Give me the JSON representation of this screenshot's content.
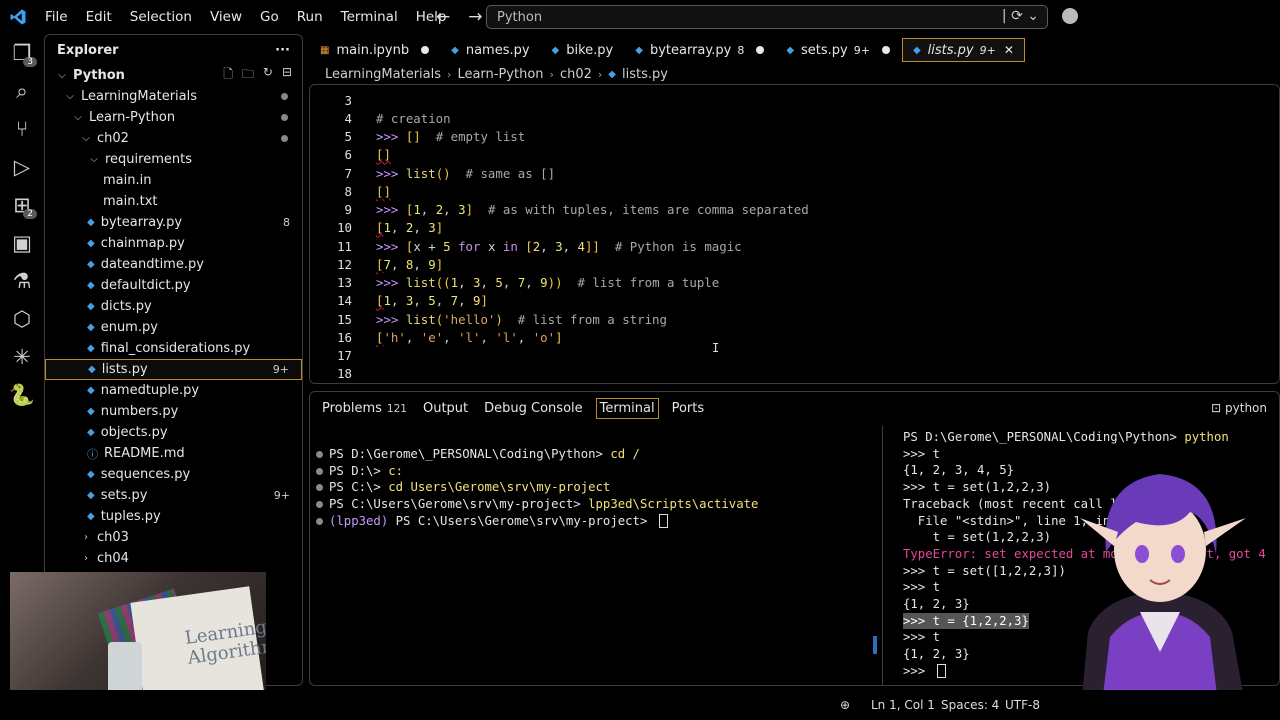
{
  "menu": [
    "File",
    "Edit",
    "Selection",
    "View",
    "Go",
    "Run",
    "Terminal",
    "Help"
  ],
  "command_center": {
    "text": "Python"
  },
  "activity": {
    "explorer_badge": "3",
    "extensions_badge": "2"
  },
  "explorer": {
    "title": "Explorer",
    "root": "Python",
    "tree": [
      {
        "label": "LearningMaterials",
        "indent": 1,
        "type": "folder-open",
        "dot": true
      },
      {
        "label": "Learn-Python",
        "indent": 2,
        "type": "folder-open",
        "dot": true
      },
      {
        "label": "ch02",
        "indent": 3,
        "type": "folder-open",
        "dot": true
      },
      {
        "label": "requirements",
        "indent": 4,
        "type": "folder-open"
      },
      {
        "label": "main.in",
        "indent": 5,
        "type": "file"
      },
      {
        "label": "main.txt",
        "indent": 5,
        "type": "file"
      },
      {
        "label": "bytearray.py",
        "indent": 4,
        "type": "py",
        "badge": "8"
      },
      {
        "label": "chainmap.py",
        "indent": 4,
        "type": "py"
      },
      {
        "label": "dateandtime.py",
        "indent": 4,
        "type": "py"
      },
      {
        "label": "defaultdict.py",
        "indent": 4,
        "type": "py"
      },
      {
        "label": "dicts.py",
        "indent": 4,
        "type": "py"
      },
      {
        "label": "enum.py",
        "indent": 4,
        "type": "py"
      },
      {
        "label": "final_considerations.py",
        "indent": 4,
        "type": "py"
      },
      {
        "label": "lists.py",
        "indent": 4,
        "type": "py",
        "badge": "9+",
        "selected": true
      },
      {
        "label": "namedtuple.py",
        "indent": 4,
        "type": "py"
      },
      {
        "label": "numbers.py",
        "indent": 4,
        "type": "py"
      },
      {
        "label": "objects.py",
        "indent": 4,
        "type": "py"
      },
      {
        "label": "README.md",
        "indent": 4,
        "type": "md"
      },
      {
        "label": "sequences.py",
        "indent": 4,
        "type": "py"
      },
      {
        "label": "sets.py",
        "indent": 4,
        "type": "py",
        "badge": "9+"
      },
      {
        "label": "tuples.py",
        "indent": 4,
        "type": "py"
      },
      {
        "label": "ch03",
        "indent": 3,
        "type": "folder-closed"
      },
      {
        "label": "ch04",
        "indent": 3,
        "type": "folder-closed"
      }
    ]
  },
  "webcam": {
    "book_title": "Learning\nAlgorithms"
  },
  "tabs": [
    {
      "label": "main.ipynb",
      "icon": "notebook",
      "dot": true
    },
    {
      "label": "names.py",
      "icon": "py"
    },
    {
      "label": "bike.py",
      "icon": "py"
    },
    {
      "label": "bytearray.py",
      "icon": "py",
      "badge": "8",
      "dot": true
    },
    {
      "label": "sets.py",
      "icon": "py",
      "badge": "9+",
      "dot": true
    },
    {
      "label": "lists.py",
      "icon": "py",
      "badge": "9+",
      "active": true
    }
  ],
  "breadcrumb": [
    "LearningMaterials",
    "Learn-Python",
    "ch02",
    "lists.py"
  ],
  "editor": {
    "lines": [
      {
        "n": "3",
        "tokens": []
      },
      {
        "n": "4",
        "tokens": [
          [
            "c-comment",
            "# creation"
          ]
        ]
      },
      {
        "n": "5",
        "tokens": [
          [
            "c-prompt",
            ">>> "
          ],
          [
            "c-op",
            "[]"
          ],
          [
            "c-plain",
            "  "
          ],
          [
            "c-comment",
            "# empty list"
          ]
        ]
      },
      {
        "n": "6",
        "tokens": [
          [
            "c-op squig",
            "[]"
          ]
        ]
      },
      {
        "n": "7",
        "tokens": [
          [
            "c-prompt",
            ">>> "
          ],
          [
            "c-fn",
            "list"
          ],
          [
            "c-op",
            "()"
          ],
          [
            "c-plain",
            "  "
          ],
          [
            "c-comment",
            "# same as []"
          ]
        ]
      },
      {
        "n": "8",
        "tokens": [
          [
            "c-op squig",
            "[]"
          ]
        ]
      },
      {
        "n": "9",
        "tokens": [
          [
            "c-prompt",
            ">>> "
          ],
          [
            "c-op",
            "["
          ],
          [
            "c-num",
            "1"
          ],
          [
            "c-plain",
            ", "
          ],
          [
            "c-num",
            "2"
          ],
          [
            "c-plain",
            ", "
          ],
          [
            "c-num",
            "3"
          ],
          [
            "c-op",
            "]"
          ],
          [
            "c-plain",
            "  "
          ],
          [
            "c-comment",
            "# as with tuples, items are comma separated"
          ]
        ]
      },
      {
        "n": "10",
        "tokens": [
          [
            "c-op squig",
            "["
          ],
          [
            "c-num",
            "1"
          ],
          [
            "c-plain",
            ", "
          ],
          [
            "c-num",
            "2"
          ],
          [
            "c-plain",
            ", "
          ],
          [
            "c-num",
            "3"
          ],
          [
            "c-op",
            "]"
          ]
        ]
      },
      {
        "n": "11",
        "tokens": [
          [
            "c-prompt",
            ">>> "
          ],
          [
            "c-op",
            "["
          ],
          [
            "c-plain",
            "x + "
          ],
          [
            "c-num",
            "5"
          ],
          [
            "c-kw",
            " for "
          ],
          [
            "c-plain",
            "x"
          ],
          [
            "c-kw",
            " in "
          ],
          [
            "c-op",
            "["
          ],
          [
            "c-num",
            "2"
          ],
          [
            "c-plain",
            ", "
          ],
          [
            "c-num",
            "3"
          ],
          [
            "c-plain",
            ", "
          ],
          [
            "c-num",
            "4"
          ],
          [
            "c-op",
            "]]"
          ],
          [
            "c-plain",
            "  "
          ],
          [
            "c-comment",
            "# Python is magic"
          ]
        ]
      },
      {
        "n": "12",
        "tokens": [
          [
            "c-op squig",
            "["
          ],
          [
            "c-num",
            "7"
          ],
          [
            "c-plain",
            ", "
          ],
          [
            "c-num",
            "8"
          ],
          [
            "c-plain",
            ", "
          ],
          [
            "c-num",
            "9"
          ],
          [
            "c-op",
            "]"
          ]
        ]
      },
      {
        "n": "13",
        "tokens": [
          [
            "c-prompt",
            ">>> "
          ],
          [
            "c-fn",
            "list"
          ],
          [
            "c-op",
            "(("
          ],
          [
            "c-num",
            "1"
          ],
          [
            "c-plain",
            ", "
          ],
          [
            "c-num",
            "3"
          ],
          [
            "c-plain",
            ", "
          ],
          [
            "c-num",
            "5"
          ],
          [
            "c-plain",
            ", "
          ],
          [
            "c-num",
            "7"
          ],
          [
            "c-plain",
            ", "
          ],
          [
            "c-num",
            "9"
          ],
          [
            "c-op",
            "))"
          ],
          [
            "c-plain",
            "  "
          ],
          [
            "c-comment",
            "# list from a tuple"
          ]
        ]
      },
      {
        "n": "14",
        "tokens": [
          [
            "c-op squig",
            "["
          ],
          [
            "c-num",
            "1"
          ],
          [
            "c-plain",
            ", "
          ],
          [
            "c-num",
            "3"
          ],
          [
            "c-plain",
            ", "
          ],
          [
            "c-num",
            "5"
          ],
          [
            "c-plain",
            ", "
          ],
          [
            "c-num",
            "7"
          ],
          [
            "c-plain",
            ", "
          ],
          [
            "c-num",
            "9"
          ],
          [
            "c-op",
            "]"
          ]
        ]
      },
      {
        "n": "15",
        "tokens": [
          [
            "c-prompt",
            ">>> "
          ],
          [
            "c-fn",
            "list"
          ],
          [
            "c-op",
            "("
          ],
          [
            "c-str",
            "'hello'"
          ],
          [
            "c-op",
            ")"
          ],
          [
            "c-plain",
            "  "
          ],
          [
            "c-comment",
            "# list from a string"
          ]
        ]
      },
      {
        "n": "16",
        "tokens": [
          [
            "c-op squig",
            "["
          ],
          [
            "c-str",
            "'h'"
          ],
          [
            "c-plain",
            ", "
          ],
          [
            "c-str",
            "'e'"
          ],
          [
            "c-plain",
            ", "
          ],
          [
            "c-str",
            "'l'"
          ],
          [
            "c-plain",
            ", "
          ],
          [
            "c-str",
            "'l'"
          ],
          [
            "c-plain",
            ", "
          ],
          [
            "c-str",
            "'o'"
          ],
          [
            "c-op",
            "]"
          ]
        ]
      },
      {
        "n": "17",
        "tokens": []
      },
      {
        "n": "18",
        "tokens": []
      }
    ]
  },
  "panel": {
    "tabs": [
      {
        "label": "Problems",
        "badge": "121"
      },
      {
        "label": "Output"
      },
      {
        "label": "Debug Console"
      },
      {
        "label": "Terminal",
        "active": true
      },
      {
        "label": "Ports"
      }
    ],
    "shell_label": "python",
    "terminal_left": [
      {
        "prompt": "PS D:\\Gerome\\_PERSONAL\\Coding\\Python> ",
        "cmd": "cd /"
      },
      {
        "prompt": "PS D:\\> ",
        "cmd": "c:"
      },
      {
        "prompt": "PS C:\\> ",
        "cmd": "cd Users\\Gerome\\srv\\my-project"
      },
      {
        "prompt": "PS C:\\Users\\Gerome\\srv\\my-project> ",
        "cmd": "lpp3ed\\Scripts\\activate"
      },
      {
        "venv": "(lpp3ed)",
        "prompt": " PS C:\\Users\\Gerome\\srv\\my-project> ",
        "cmd": "",
        "cursor": true
      }
    ],
    "terminal_right": {
      "header_prompt": "PS D:\\Gerome\\_PERSONAL\\Coding\\Python> ",
      "header_cmd": "python",
      "lines": [
        ">>> t",
        "{1, 2, 3, 4, 5}",
        ">>> t = set(1,2,2,3)",
        "Traceback (most recent call last):",
        "  File \"<stdin>\", line 1, in <module>",
        "    t = set(1,2,2,3)",
        "TypeError: set expected at most 1 argument, got 4",
        ">>> t = set([1,2,2,3])",
        ">>> t",
        "{1, 2, 3}",
        ">>> t = {1,2,2,3}",
        ">>> t",
        "{1, 2, 3}",
        ">>> "
      ]
    }
  },
  "status": {
    "position": "Ln 1, Col 1",
    "spaces": "Spaces: 4",
    "encoding": "UTF-8"
  },
  "colors": {
    "accent": "#c08a2b",
    "python_blue": "#4a9fe0",
    "avatar_purple": "#7b3fc4"
  }
}
